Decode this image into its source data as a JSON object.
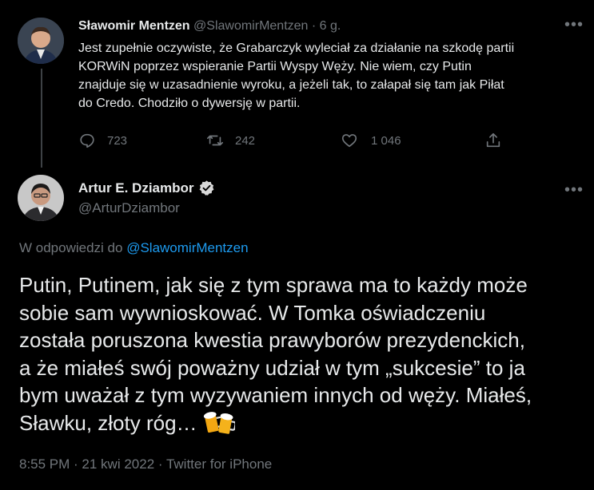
{
  "parent_tweet": {
    "display_name": "Sławomir Mentzen",
    "handle": "@SlawomirMentzen",
    "separator": "·",
    "time": "6 g.",
    "text_lines": [
      "Jest zupełnie oczywiste, że Grabarczyk wyleciał za działanie na szkodę partii",
      "KORWiN poprzez wspieranie Partii Wyspy Węży. Nie wiem, czy Putin",
      "znajduje się w uzasadnienie wyroku, a jeżeli tak, to załapał się tam jak Piłat",
      "do Credo. Chodziło o dywersję w partii."
    ],
    "replies": "723",
    "retweets": "242",
    "likes": "1 046"
  },
  "main_tweet": {
    "display_name": "Artur E. Dziambor",
    "handle": "@ArturDziambor",
    "reply_to_prefix": "W odpowiedzi do",
    "reply_to_handle": "@SlawomirMentzen",
    "text_lines": [
      "Putin, Putinem, jak się z tym sprawa ma to każdy może",
      "sobie sam wywnioskować. W Tomka oświadczeniu",
      "została poruszona kwestia prawyborów prezydenckich,",
      "a że miałeś swój poważny udział w tym „sukcesie” to ja",
      "bym uważał z tym wyzywaniem innych od węży. Miałeś,",
      "Sławku, złoty róg… "
    ],
    "timestamp": "8:55 PM · 21 kwi 2022 · Twitter for iPhone"
  },
  "icons": {
    "reply": "reply-icon",
    "retweet": "retweet-icon",
    "like": "heart-icon",
    "share": "share-icon",
    "more": "more-icon",
    "verified": "verified-badge-icon",
    "beer": "beer-mugs-emoji-icon"
  },
  "colors": {
    "background": "#000000",
    "primary_text": "#e7e9ea",
    "secondary_text": "#71767b",
    "link": "#1d9bf0",
    "thread_line": "#3d4145"
  }
}
